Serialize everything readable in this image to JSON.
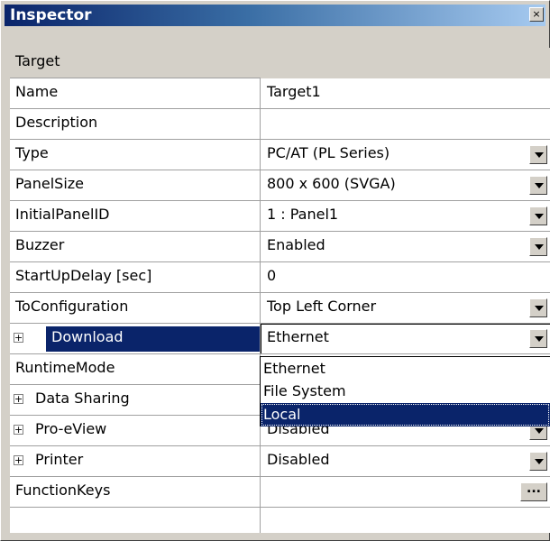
{
  "window": {
    "title": "Inspector",
    "close_label": "×"
  },
  "category": {
    "label": "Target"
  },
  "rows": [
    {
      "name": "Name",
      "value": "Target1"
    },
    {
      "name": "Description",
      "value": ""
    },
    {
      "name": "Type",
      "value": "PC/AT (PL Series)"
    },
    {
      "name": "PanelSize",
      "value": "800 x 600 (SVGA)"
    },
    {
      "name": "InitialPanelID",
      "value": "1 : Panel1"
    },
    {
      "name": "Buzzer",
      "value": "Enabled"
    },
    {
      "name": "StartUpDelay [sec]",
      "value": "0"
    },
    {
      "name": "ToConfiguration",
      "value": "Top Left Corner"
    },
    {
      "name": "Download",
      "value": "Ethernet"
    },
    {
      "name": "RuntimeMode",
      "value": ""
    },
    {
      "name": "Data Sharing",
      "value": ""
    },
    {
      "name": "Pro-eView",
      "value": "Disabled"
    },
    {
      "name": "Printer",
      "value": "Disabled"
    },
    {
      "name": "FunctionKeys",
      "value": ""
    }
  ],
  "expander_symbol": "+",
  "ellipsis_label": "...",
  "dropdown": {
    "options": [
      "Ethernet",
      "File System",
      "Local"
    ],
    "selected_index": 2
  },
  "colors": {
    "selection": "#0a246a",
    "title_start": "#0a246a",
    "title_end": "#a6caf0"
  }
}
